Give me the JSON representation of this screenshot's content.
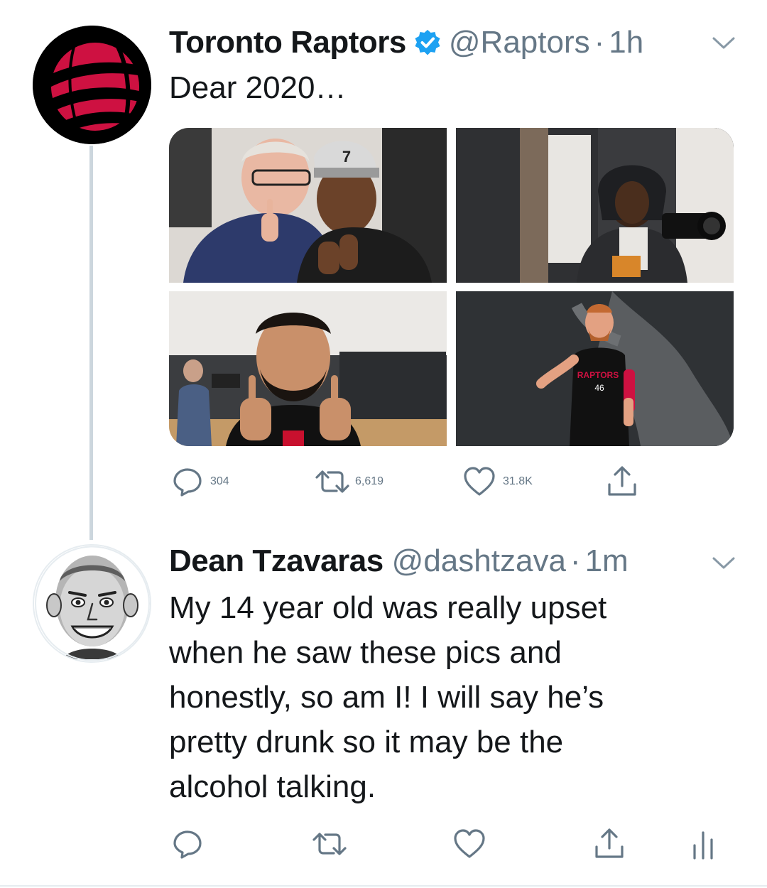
{
  "tweets": [
    {
      "name": "Toronto Raptors",
      "verified": true,
      "handle": "@Raptors",
      "dot": "·",
      "time": "1h",
      "text": "Dear 2020…",
      "media_count": 4,
      "actions": {
        "replies": "304",
        "retweets": "6,619",
        "likes": "31.8K"
      },
      "avatar_icon": "raptors-logo-icon"
    },
    {
      "name": "Dean Tzavaras",
      "verified": false,
      "handle": "@dashtzava",
      "dot": "·",
      "time": "1m",
      "text_lines": [
        "My 14 year old was really upset",
        "when he saw these pics and",
        "honestly, so am I!  I will say he’s",
        "pretty drunk so it may be the",
        "alcohol talking."
      ],
      "avatar_icon": "caricature-avatar-icon"
    }
  ],
  "colors": {
    "text": "#14171a",
    "secondary": "#657786",
    "verified": "#1da1f2",
    "thread_line": "#ccd6dd",
    "raptors_red": "#ce1141"
  }
}
